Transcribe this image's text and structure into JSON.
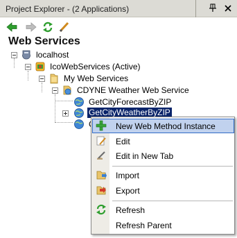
{
  "panel": {
    "title": "Project Explorer - (2 Applications)",
    "heading": "Web Services"
  },
  "toolbar": {
    "buttons": [
      {
        "icon": "back-arrow-icon"
      },
      {
        "icon": "forward-arrow-icon"
      },
      {
        "icon": "refresh-icon"
      },
      {
        "icon": "pencil-icon"
      }
    ]
  },
  "tree": {
    "localhost": "localhost",
    "project": "IcoWebServices (Active)",
    "folder": "My Web Services",
    "service": "CDYNE Weather Web Service",
    "methods": [
      {
        "label": "GetCityForecastByZIP"
      },
      {
        "label": "GetCityWeatherByZIP"
      },
      {
        "label": "G"
      }
    ]
  },
  "context_menu": {
    "items": [
      {
        "label": "New Web Method Instance",
        "icon": "add-green-plus-icon"
      },
      {
        "label": "Edit",
        "icon": "edit-icon"
      },
      {
        "label": "Edit in New Tab",
        "icon": "edit-new-tab-icon"
      },
      {
        "label": "Import",
        "icon": "import-icon"
      },
      {
        "label": "Export",
        "icon": "export-icon"
      },
      {
        "label": "Refresh",
        "icon": "refresh-icon"
      },
      {
        "label": "Refresh Parent",
        "icon": ""
      }
    ]
  },
  "colors": {
    "selection": "#0a246a",
    "menu_highlight": "#c1d2ee",
    "menu_highlight_border": "#316ac5"
  }
}
